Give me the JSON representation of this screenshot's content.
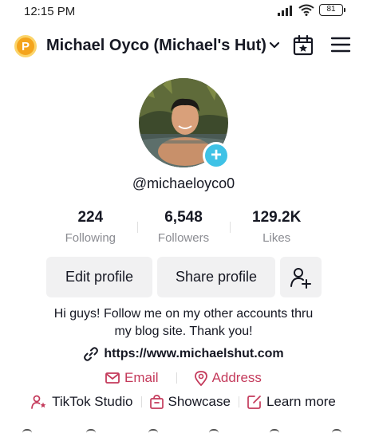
{
  "status_bar": {
    "time": "12:15 PM",
    "battery": "81",
    "icons": [
      "signal-icon",
      "wifi-icon",
      "battery-icon"
    ]
  },
  "header": {
    "coin_letter": "P",
    "account_name": "Michael Oyco (Michael's  Hut)",
    "icons": [
      "chevron-down-icon",
      "calendar-star-icon",
      "menu-icon"
    ]
  },
  "profile": {
    "username": "@michaeloyco0",
    "stats": [
      {
        "value": "224",
        "label": "Following"
      },
      {
        "value": "6,548",
        "label": "Followers"
      },
      {
        "value": "129.2K",
        "label": "Likes"
      }
    ],
    "edit_label": "Edit profile",
    "share_label": "Share profile",
    "bio_line1": "Hi guys! Follow me on my other accounts thru",
    "bio_line2": "my blog site. Thank you!",
    "link": "https://www.michaelshut.com",
    "email_label": "Email",
    "address_label": "Address",
    "studio_label": "TikTok Studio",
    "showcase_label": "Showcase",
    "learn_more_label": "Learn more"
  },
  "colors": {
    "accent": "#c43a5b",
    "plus_badge": "#3fc2e6",
    "coin": "#f4a41c",
    "button_bg": "#f1f1f2",
    "muted_text": "#8a8b91"
  }
}
